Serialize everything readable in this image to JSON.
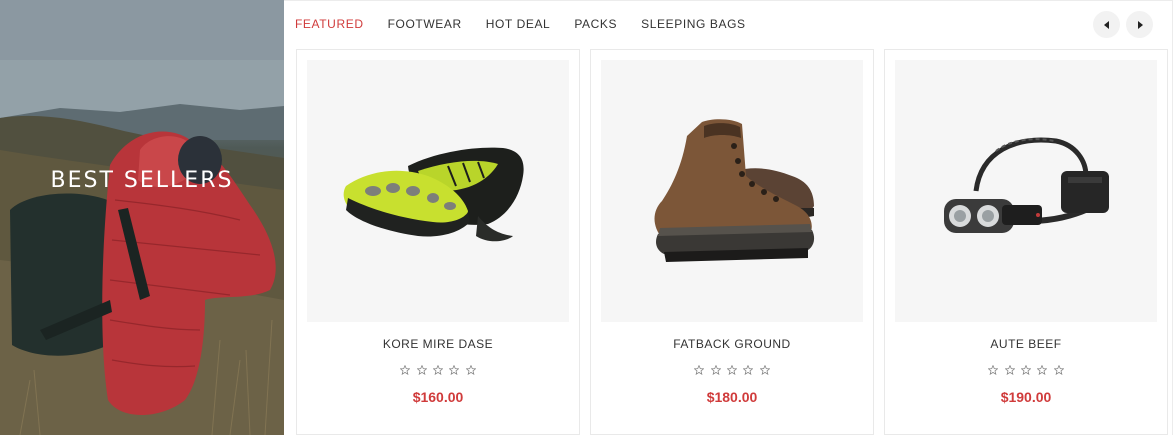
{
  "hero": {
    "title": "BEST SELLERS"
  },
  "tabs": [
    {
      "label": "FEATURED",
      "active": true
    },
    {
      "label": "FOOTWEAR",
      "active": false
    },
    {
      "label": "HOT DEAL",
      "active": false
    },
    {
      "label": "PACKS",
      "active": false
    },
    {
      "label": "SLEEPING BAGS",
      "active": false
    }
  ],
  "carousel_nav": {
    "prev_icon": "caret-left-icon",
    "next_icon": "caret-right-icon"
  },
  "products": [
    {
      "name": "KORE MIRE DASE",
      "price": "$160.00",
      "rating": 0,
      "max_rating": 5,
      "image": "toe-shoe"
    },
    {
      "name": "FATBACK GROUND",
      "price": "$180.00",
      "rating": 0,
      "max_rating": 5,
      "image": "hiking-boot"
    },
    {
      "name": "AUTE BEEF",
      "price": "$190.00",
      "rating": 0,
      "max_rating": 5,
      "image": "headlamp"
    }
  ],
  "colors": {
    "accent": "#d03b3b",
    "text": "#333333",
    "thumb_bg": "#f6f6f6"
  }
}
